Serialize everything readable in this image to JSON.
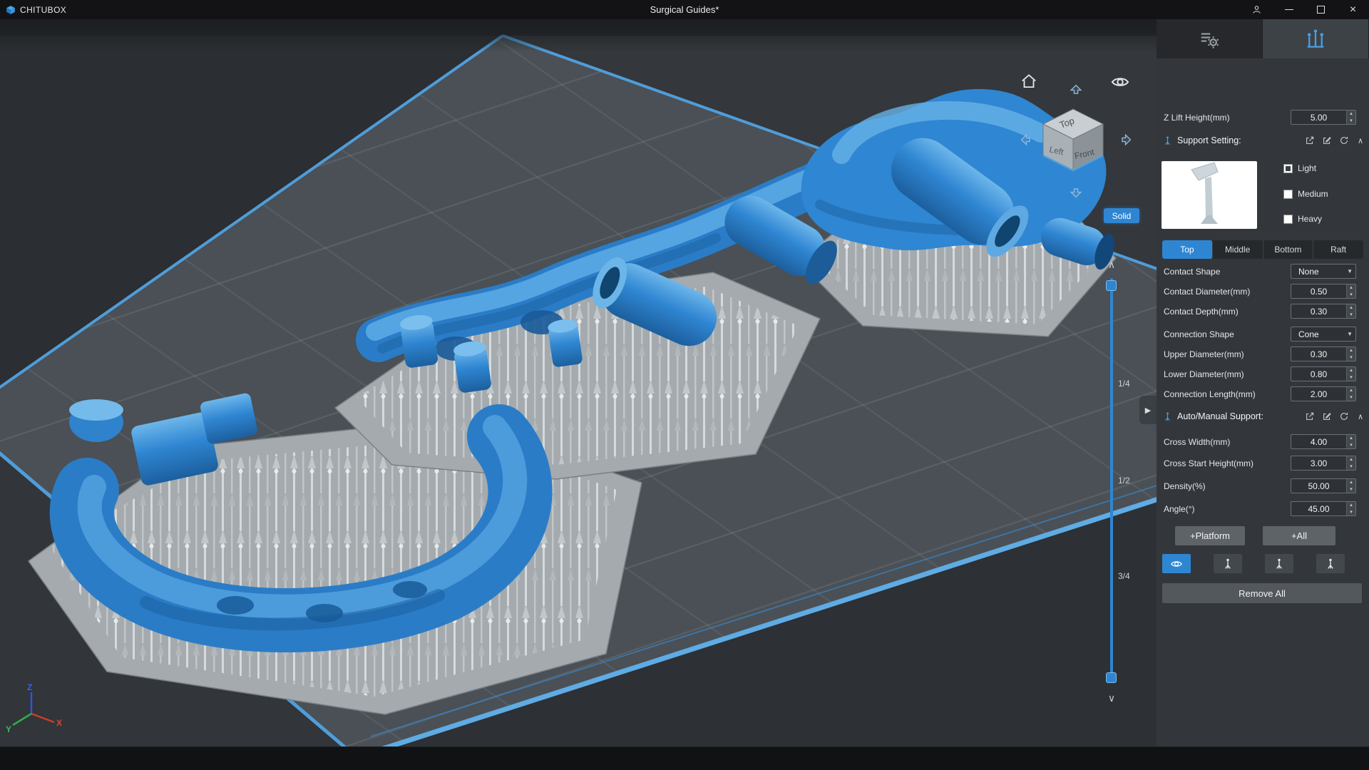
{
  "titlebar": {
    "app_name": "CHITUBOX",
    "document_title": "Surgical Guides*"
  },
  "viewport": {
    "render_mode": "Solid",
    "nav_cube": {
      "top": "Top",
      "left": "Left",
      "front": "Front"
    },
    "slice_slider": {
      "labels": [
        "1/4",
        "1/2",
        "3/4"
      ]
    },
    "axes": {
      "x": "X",
      "y": "Y",
      "z": "Z"
    }
  },
  "panel": {
    "z_lift": {
      "label": "Z Lift Height(mm)",
      "value": "5.00"
    },
    "support_setting_header": "Support Setting:",
    "support_density_options": [
      "Light",
      "Medium",
      "Heavy"
    ],
    "section_tabs": [
      "Top",
      "Middle",
      "Bottom",
      "Raft"
    ],
    "active_section_tab": "Top",
    "top_fields": [
      {
        "label": "Contact Shape",
        "value": "None",
        "control": "select"
      },
      {
        "label": "Contact Diameter(mm)",
        "value": "0.50",
        "control": "number"
      },
      {
        "label": "Contact Depth(mm)",
        "value": "0.30",
        "control": "number"
      },
      {
        "label": "Connection Shape",
        "value": "Cone",
        "control": "select"
      },
      {
        "label": "Upper Diameter(mm)",
        "value": "0.30",
        "control": "number"
      },
      {
        "label": "Lower Diameter(mm)",
        "value": "0.80",
        "control": "number"
      },
      {
        "label": "Connection Length(mm)",
        "value": "2.00",
        "control": "number"
      }
    ],
    "auto_manual_header": "Auto/Manual Support:",
    "auto_fields": [
      {
        "label": "Cross Width(mm)",
        "value": "4.00"
      },
      {
        "label": "Cross Start Height(mm)",
        "value": "3.00"
      },
      {
        "label": "Density(%)",
        "value": "50.00"
      },
      {
        "label": "Angle(°)",
        "value": "45.00"
      }
    ],
    "add_platform_button": "+Platform",
    "add_all_button": "+All",
    "remove_all_button": "Remove All"
  },
  "icons": {
    "spinner_up": "▴",
    "spinner_down": "▾",
    "dropdown_arrow": "▼",
    "collapse_chevron": "∧",
    "slider_chevron_up": "∧",
    "slider_chevron_down": "∨",
    "panel_expand_arrow": "▶",
    "close_glyph": "×"
  },
  "colors": {
    "accent_blue": "#2e86d3",
    "model_blue": "#2f86d2",
    "support_gray": "#d6dadc",
    "panel_bg": "#33373c",
    "titlebar_bg": "#131316"
  }
}
